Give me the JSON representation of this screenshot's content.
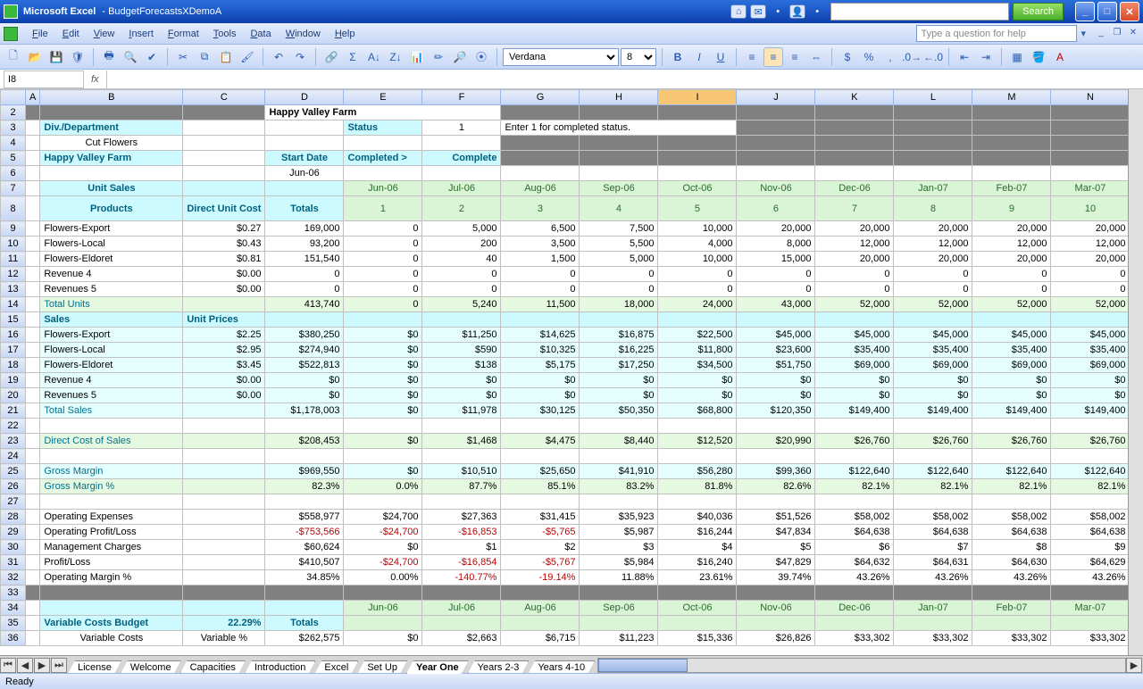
{
  "titlebar": {
    "app": "Microsoft Excel",
    "doc": "BudgetForecastsXDemoA",
    "search_btn": "Search"
  },
  "menu": [
    "File",
    "Edit",
    "View",
    "Insert",
    "Format",
    "Tools",
    "Data",
    "Window",
    "Help"
  ],
  "help_placeholder": "Type a question for help",
  "font": "Verdana",
  "fontsize": "8",
  "namebox": "I8",
  "fx": "fx",
  "status": "Ready",
  "cols": [
    "A",
    "B",
    "C",
    "D",
    "E",
    "F",
    "G",
    "H",
    "I",
    "J",
    "K",
    "L",
    "M",
    "N"
  ],
  "active_col": "I",
  "months": [
    "Jun-06",
    "Jul-06",
    "Aug-06",
    "Sep-06",
    "Oct-06",
    "Nov-06",
    "Dec-06",
    "Jan-07",
    "Feb-07",
    "Mar-07"
  ],
  "month_nums": [
    "1",
    "2",
    "3",
    "4",
    "5",
    "6",
    "7",
    "8",
    "9",
    "10"
  ],
  "sec": {
    "title": "Happy Valley Farm",
    "div_dept": "Div./Department",
    "div_val": "Cut Flowers",
    "unit": "Happy Valley Farm",
    "status_lbl": "Status",
    "status_val": "1",
    "status_note": "Enter 1 for completed status.",
    "start_date_lbl": "Start Date",
    "start_date_val": "Jun-06",
    "completed": "Completed >",
    "complete": "Complete",
    "unit_sales": "Unit Sales",
    "products": "Products",
    "duc": "Direct Unit Cost",
    "totals": "Totals",
    "sales_lbl": "Sales",
    "unit_prices": "Unit Prices",
    "dcs": "Direct Cost of Sales",
    "gm": "Gross Margin",
    "gmp": "Gross Margin %",
    "opex": "Operating Expenses",
    "opl": "Operating Profit/Loss",
    "mgmt": "Management Charges",
    "pl": "Profit/Loss",
    "opm": "Operating Margin %",
    "vcb": "Variable Costs Budget",
    "vc": "Variable Costs",
    "varp": "Variable %",
    "tot_units": "Total Units",
    "tot_sales": "Total Sales"
  },
  "rows_sales": [
    {
      "name": "Flowers-Export",
      "duc": "$0.27",
      "tot": "169,000",
      "v": [
        "0",
        "5,000",
        "6,500",
        "7,500",
        "10,000",
        "20,000",
        "20,000",
        "20,000",
        "20,000",
        "20,000"
      ]
    },
    {
      "name": "Flowers-Local",
      "duc": "$0.43",
      "tot": "93,200",
      "v": [
        "0",
        "200",
        "3,500",
        "5,500",
        "4,000",
        "8,000",
        "12,000",
        "12,000",
        "12,000",
        "12,000"
      ]
    },
    {
      "name": "Flowers-Eldoret",
      "duc": "$0.81",
      "tot": "151,540",
      "v": [
        "0",
        "40",
        "1,500",
        "5,000",
        "10,000",
        "15,000",
        "20,000",
        "20,000",
        "20,000",
        "20,000"
      ]
    },
    {
      "name": "Revenue 4",
      "duc": "$0.00",
      "tot": "0",
      "v": [
        "0",
        "0",
        "0",
        "0",
        "0",
        "0",
        "0",
        "0",
        "0",
        "0"
      ]
    },
    {
      "name": "Revenues 5",
      "duc": "$0.00",
      "tot": "0",
      "v": [
        "0",
        "0",
        "0",
        "0",
        "0",
        "0",
        "0",
        "0",
        "0",
        "0"
      ]
    }
  ],
  "total_units": {
    "tot": "413,740",
    "v": [
      "0",
      "5,240",
      "11,500",
      "18,000",
      "24,000",
      "43,000",
      "52,000",
      "52,000",
      "52,000",
      "52,000"
    ]
  },
  "rows_rev": [
    {
      "name": "Flowers-Export",
      "up": "$2.25",
      "tot": "$380,250",
      "v": [
        "$0",
        "$11,250",
        "$14,625",
        "$16,875",
        "$22,500",
        "$45,000",
        "$45,000",
        "$45,000",
        "$45,000",
        "$45,000"
      ]
    },
    {
      "name": "Flowers-Local",
      "up": "$2.95",
      "tot": "$274,940",
      "v": [
        "$0",
        "$590",
        "$10,325",
        "$16,225",
        "$11,800",
        "$23,600",
        "$35,400",
        "$35,400",
        "$35,400",
        "$35,400"
      ]
    },
    {
      "name": "Flowers-Eldoret",
      "up": "$3.45",
      "tot": "$522,813",
      "v": [
        "$0",
        "$138",
        "$5,175",
        "$17,250",
        "$34,500",
        "$51,750",
        "$69,000",
        "$69,000",
        "$69,000",
        "$69,000"
      ]
    },
    {
      "name": "Revenue 4",
      "up": "$0.00",
      "tot": "$0",
      "v": [
        "$0",
        "$0",
        "$0",
        "$0",
        "$0",
        "$0",
        "$0",
        "$0",
        "$0",
        "$0"
      ]
    },
    {
      "name": "Revenues 5",
      "up": "$0.00",
      "tot": "$0",
      "v": [
        "$0",
        "$0",
        "$0",
        "$0",
        "$0",
        "$0",
        "$0",
        "$0",
        "$0",
        "$0"
      ]
    }
  ],
  "total_sales": {
    "tot": "$1,178,003",
    "v": [
      "$0",
      "$11,978",
      "$30,125",
      "$50,350",
      "$68,800",
      "$120,350",
      "$149,400",
      "$149,400",
      "$149,400",
      "$149,400"
    ]
  },
  "dcs_row": {
    "tot": "$208,453",
    "v": [
      "$0",
      "$1,468",
      "$4,475",
      "$8,440",
      "$12,520",
      "$20,990",
      "$26,760",
      "$26,760",
      "$26,760",
      "$26,760"
    ]
  },
  "gm_row": {
    "tot": "$969,550",
    "v": [
      "$0",
      "$10,510",
      "$25,650",
      "$41,910",
      "$56,280",
      "$99,360",
      "$122,640",
      "$122,640",
      "$122,640",
      "$122,640"
    ]
  },
  "gmp_row": {
    "tot": "82.3%",
    "v": [
      "0.0%",
      "87.7%",
      "85.1%",
      "83.2%",
      "81.8%",
      "82.6%",
      "82.1%",
      "82.1%",
      "82.1%",
      "82.1%"
    ]
  },
  "opex_row": {
    "tot": "$558,977",
    "v": [
      "$24,700",
      "$27,363",
      "$31,415",
      "$35,923",
      "$40,036",
      "$51,526",
      "$58,002",
      "$58,002",
      "$58,002",
      "$58,002"
    ]
  },
  "opl_row": {
    "tot": "-$753,566",
    "v": [
      "-$24,700",
      "-$16,853",
      "-$5,765",
      "$5,987",
      "$16,244",
      "$47,834",
      "$64,638",
      "$64,638",
      "$64,638",
      "$64,638"
    ],
    "neg": [
      true,
      true,
      true,
      true,
      false,
      false,
      false,
      false,
      false,
      false,
      false
    ]
  },
  "mgmt_row": {
    "tot": "$60,624",
    "v": [
      "$0",
      "$1",
      "$2",
      "$3",
      "$4",
      "$5",
      "$6",
      "$7",
      "$8",
      "$9"
    ]
  },
  "pl_row": {
    "tot": "$410,507",
    "v": [
      "-$24,700",
      "-$16,854",
      "-$5,767",
      "$5,984",
      "$16,240",
      "$47,829",
      "$64,632",
      "$64,631",
      "$64,630",
      "$64,629"
    ],
    "neg": [
      false,
      true,
      true,
      true,
      false,
      false,
      false,
      false,
      false,
      false,
      false
    ]
  },
  "opm_row": {
    "tot": "34.85%",
    "v": [
      "0.00%",
      "-140.77%",
      "-19.14%",
      "11.88%",
      "23.61%",
      "39.74%",
      "43.26%",
      "43.26%",
      "43.26%",
      "43.26%"
    ],
    "neg": [
      false,
      false,
      true,
      true,
      false,
      false,
      false,
      false,
      false,
      false,
      false
    ]
  },
  "vcb_pct": "22.29%",
  "vc_row": {
    "tot": "$262,575",
    "v": [
      "$0",
      "$2,663",
      "$6,715",
      "$11,223",
      "$15,336",
      "$26,826",
      "$33,302",
      "$33,302",
      "$33,302",
      "$33,302"
    ]
  },
  "tabs": [
    "License",
    "Welcome",
    "Capacities",
    "Introduction",
    "Excel",
    "Set Up",
    "Year One",
    "Years 2-3",
    "Years 4-10"
  ],
  "active_tab": "Year One"
}
